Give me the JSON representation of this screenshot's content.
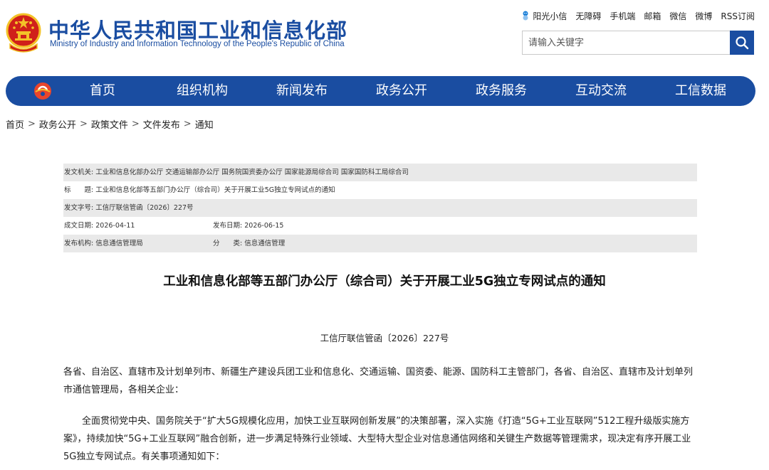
{
  "header": {
    "title": "中华人民共和国工业和信息化部",
    "subtitle": "Ministry of Industry and Information Technology of the People's Republic of China",
    "top_links": [
      "阳光小信",
      "无障碍",
      "手机端",
      "邮箱",
      "微信",
      "微博",
      "RSS订阅"
    ],
    "search_placeholder": "请输入关键字"
  },
  "nav": {
    "items": [
      "首页",
      "组织机构",
      "新闻发布",
      "政务公开",
      "政务服务",
      "互动交流",
      "工信数据"
    ]
  },
  "breadcrumb": [
    "首页",
    "政务公开",
    "政策文件",
    "文件发布",
    "通知"
  ],
  "breadcrumb_sep": ">",
  "meta": {
    "issuer_label": "发文机关:",
    "issuer": "工业和信息化部办公厅 交通运输部办公厅 国务院国资委办公厅 国家能源局综合司 国家国防科工局综合司",
    "title_label": "标　　题:",
    "title": "工业和信息化部等五部门办公厅（综合司）关于开展工业5G独立专网试点的通知",
    "doc_no_label": "发文字号:",
    "doc_no": "工信厅联信管函〔2026〕227号",
    "created_label": "成文日期:",
    "created": "2026-04-11",
    "published_label": "发布日期:",
    "published": "2026-06-15",
    "agency_label": "发布机构:",
    "agency": "信息通信管理局",
    "category_label": "分　　类:",
    "category": "信息通信管理"
  },
  "document": {
    "title": "工业和信息化部等五部门办公厅（综合司）关于开展工业5G独立专网试点的通知",
    "number": "工信厅联信管函〔2026〕227号",
    "para1": "各省、自治区、直辖市及计划单列市、新疆生产建设兵团工业和信息化、交通运输、国资委、能源、国防科工主管部门，各省、自治区、直辖市及计划单列市通信管理局，各相关企业：",
    "para2": "全面贯彻党中央、国务院关于“扩大5G规模化应用，加快工业互联网创新发展”的决策部署，深入实施《打造“5G+工业互联网”512工程升级版实施方案》，持续加快“5G+工业互联网”融合创新，进一步满足特殊行业领域、大型特大型企业对信息通信网络和关键生产数据等管理需求，现决定有序开展工业5G独立专网试点。有关事项通知如下："
  },
  "colors": {
    "brand_blue": "#1a4da1",
    "meta_shade": "#e9e9e9",
    "emblem_red": "#d0201a",
    "emblem_gold": "#f3c228"
  }
}
